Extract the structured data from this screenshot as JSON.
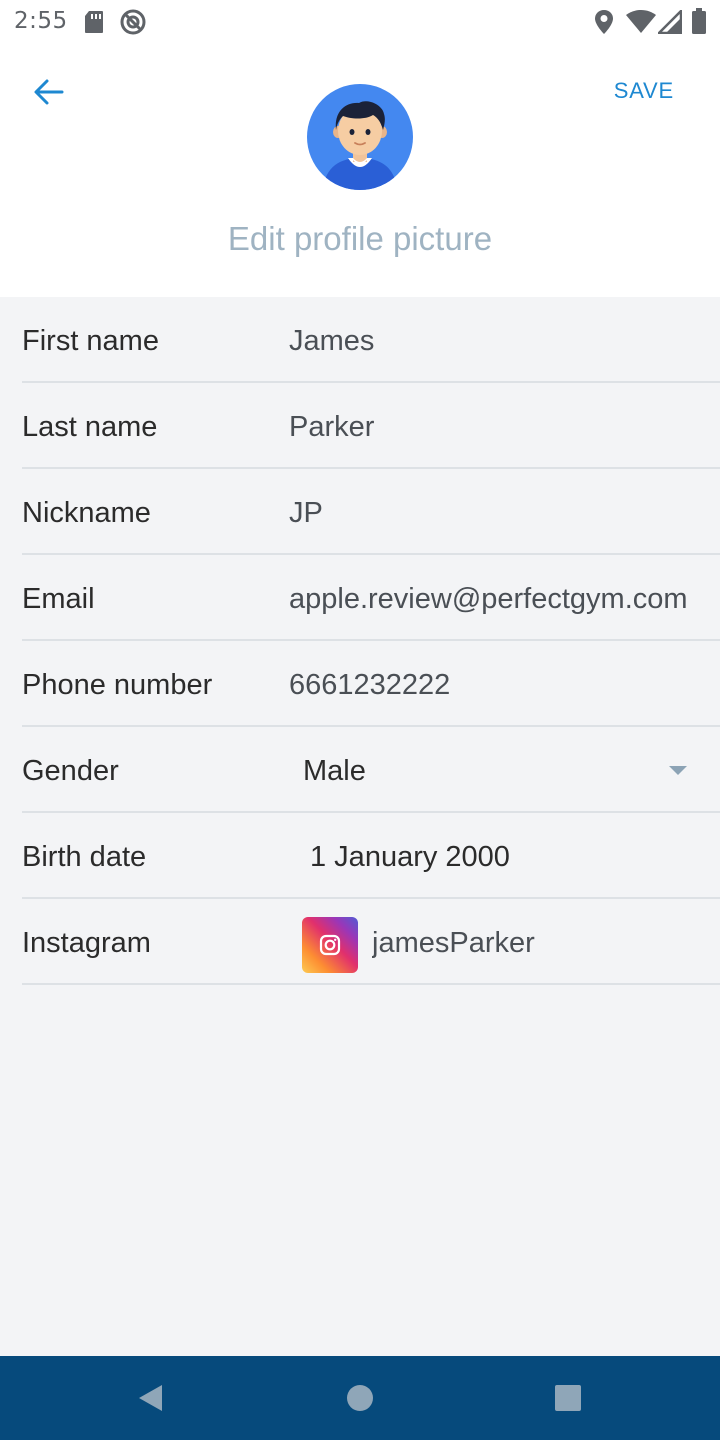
{
  "status_bar": {
    "time": "2:55",
    "left_icons": [
      "sd-card-icon",
      "no-disturb-icon"
    ],
    "right_icons": [
      "location-icon",
      "wifi-icon",
      "signal-icon",
      "battery-icon"
    ]
  },
  "header": {
    "back_icon": "arrow-left-icon",
    "save_label": "SAVE",
    "edit_picture_label": "Edit profile picture",
    "accent_color": "#1e88d1"
  },
  "form": {
    "first_name": {
      "label": "First name",
      "value": "James"
    },
    "last_name": {
      "label": "Last name",
      "value": "Parker"
    },
    "nickname": {
      "label": "Nickname",
      "value": "JP"
    },
    "email": {
      "label": "Email",
      "value": "apple.review@perfectgym.com"
    },
    "phone": {
      "label": "Phone number",
      "value": "6661232222"
    },
    "gender": {
      "label": "Gender",
      "value": "Male"
    },
    "birth_date": {
      "label": "Birth date",
      "value": "1 January 2000"
    },
    "instagram": {
      "label": "Instagram",
      "value": "jamesParker",
      "icon": "instagram-icon"
    }
  },
  "nav_bar": {
    "color": "#064a7c",
    "buttons": [
      "back-nav-icon",
      "home-nav-icon",
      "recents-nav-icon"
    ]
  }
}
